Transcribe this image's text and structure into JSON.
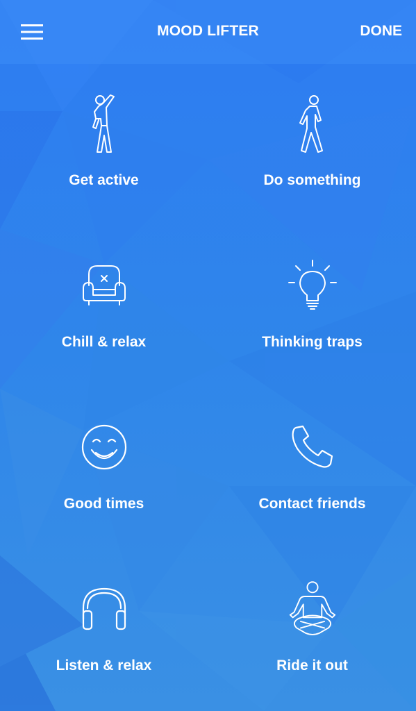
{
  "header": {
    "title": "MOOD LIFTER",
    "done_label": "DONE"
  },
  "tiles": [
    {
      "label": "Get active",
      "icon": "stretching-person-icon"
    },
    {
      "label": "Do something",
      "icon": "walking-person-icon"
    },
    {
      "label": "Chill & relax",
      "icon": "armchair-icon"
    },
    {
      "label": "Thinking traps",
      "icon": "lightbulb-icon"
    },
    {
      "label": "Good times",
      "icon": "smiley-face-icon"
    },
    {
      "label": "Contact friends",
      "icon": "phone-icon"
    },
    {
      "label": "Listen & relax",
      "icon": "headphones-icon"
    },
    {
      "label": "Ride it out",
      "icon": "meditating-person-icon"
    }
  ],
  "colors": {
    "background_top": "#2f7ff0",
    "background_bottom": "#3c92e6",
    "text": "#ffffff"
  }
}
